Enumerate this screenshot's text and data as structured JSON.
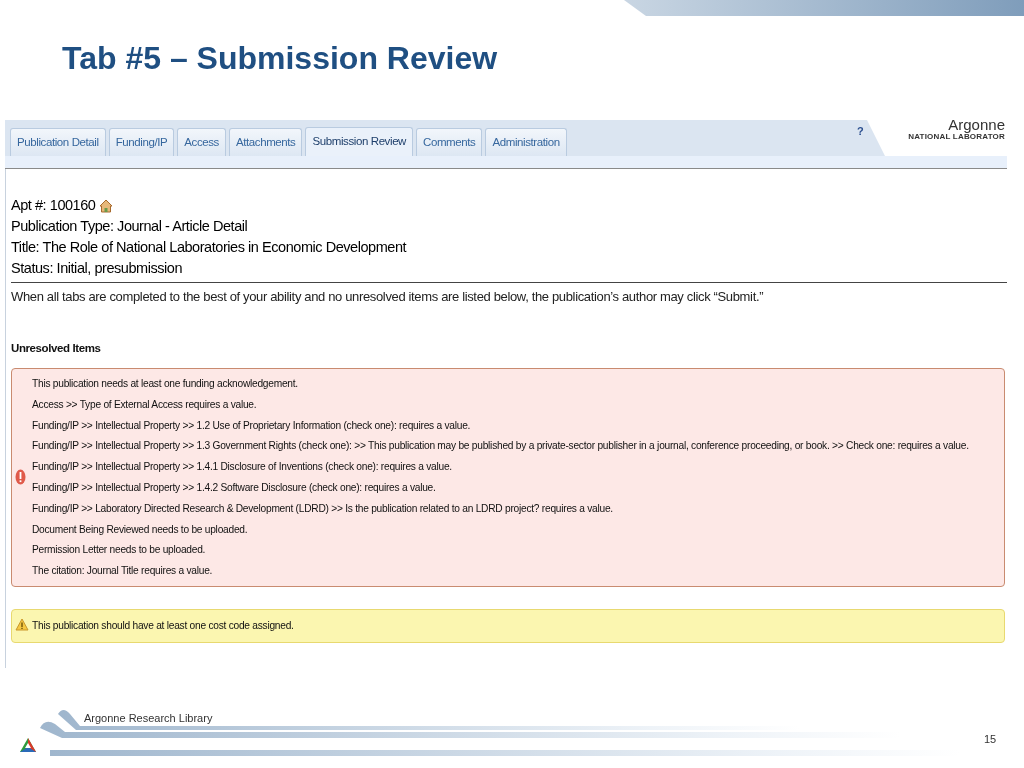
{
  "slide": {
    "title": "Tab #5 – Submission Review",
    "footer": "Argonne Research Library",
    "page_number": "15"
  },
  "app": {
    "tabs": [
      {
        "label": "Publication Detail",
        "selected": false
      },
      {
        "label": "Funding/IP",
        "selected": false
      },
      {
        "label": "Access",
        "selected": false
      },
      {
        "label": "Attachments",
        "selected": false
      },
      {
        "label": "Submission Review",
        "selected": true
      },
      {
        "label": "Comments",
        "selected": false
      },
      {
        "label": "Administration",
        "selected": false
      }
    ],
    "help": "?",
    "logo": {
      "name": "Argonne",
      "subtitle": "NATIONAL LABORATOR"
    }
  },
  "record": {
    "apt": "Apt #: 100160",
    "type": "Publication Type: Journal - Article Detail",
    "title": "Title: The Role of National Laboratories in Economic Development",
    "status": "Status: Initial, presubmission"
  },
  "instruction": "When all tabs are completed to the best of your ability and no unresolved items are listed below, the publication’s author may click “Submit.”",
  "unresolved": {
    "heading": "Unresolved Items",
    "errors": [
      "This publication needs at least one funding acknowledgement.",
      "Access >> Type of External Access requires a value.",
      "Funding/IP >> Intellectual Property >> 1.2 Use of Proprietary Information (check one): requires a value.",
      "Funding/IP >> Intellectual Property >> 1.3 Government Rights (check one): >> This publication may be published by a private-sector publisher in a journal, conference proceeding, or book. >> Check one: requires a value.",
      "Funding/IP >> Intellectual Property >> 1.4.1 Disclosure of Inventions (check one): requires a value.",
      "Funding/IP >> Intellectual Property >> 1.4.2 Software Disclosure (check one): requires a value.",
      "Funding/IP >> Laboratory Directed Research & Development (LDRD) >> Is the publication related to an LDRD project? requires a value.",
      "Document Being Reviewed needs to be uploaded.",
      "Permission Letter needs to be uploaded.",
      "The citation: Journal Title requires a value."
    ],
    "warnings": [
      "This publication should have at least one cost code assigned."
    ]
  }
}
